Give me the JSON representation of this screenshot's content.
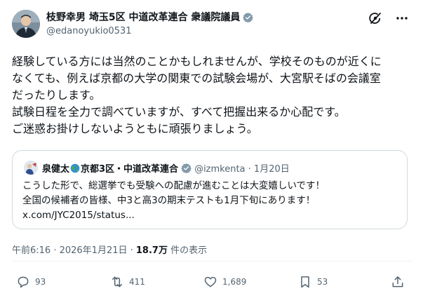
{
  "author": {
    "name": "枝野幸男 埼玉5区 中道改革連合 衆議院議員",
    "handle": "@edanoyukio0531"
  },
  "post": {
    "lines": [
      "経験している方には当然のことかもしれませんが、学校そのものが近くに",
      "なくても、例えば京都の大学の関東での試験会場が、大宮駅そばの会議室",
      "だったりします。",
      "試験日程を全力で調べていますが、すべて把握出来るか心配です。",
      "ご迷惑お掛けしないようともに頑張りましょう。"
    ]
  },
  "quote": {
    "name_part1": "泉健太",
    "name_part2": "京都3区・中道改革連合",
    "handle_date": "@izmkenta · 1月20日",
    "lines": [
      "こうした形で、総選挙でも受験への配慮が進むことは大変嬉しいです！",
      "全国の候補者の皆様、中3と高3の期末テストも1月下旬にあります！",
      "x.com/JYC2015/status..."
    ]
  },
  "meta": {
    "time": "午前6:16 · 2026年1月21日 · ",
    "views": "18.7万",
    "views_suffix": " 件の表示"
  },
  "actions": {
    "replies": "93",
    "reposts": "411",
    "likes": "1,689",
    "bookmarks": "53"
  },
  "colors": {
    "verified": "#829aab",
    "secondary_text": "#536471",
    "border": "#cfd9de"
  }
}
